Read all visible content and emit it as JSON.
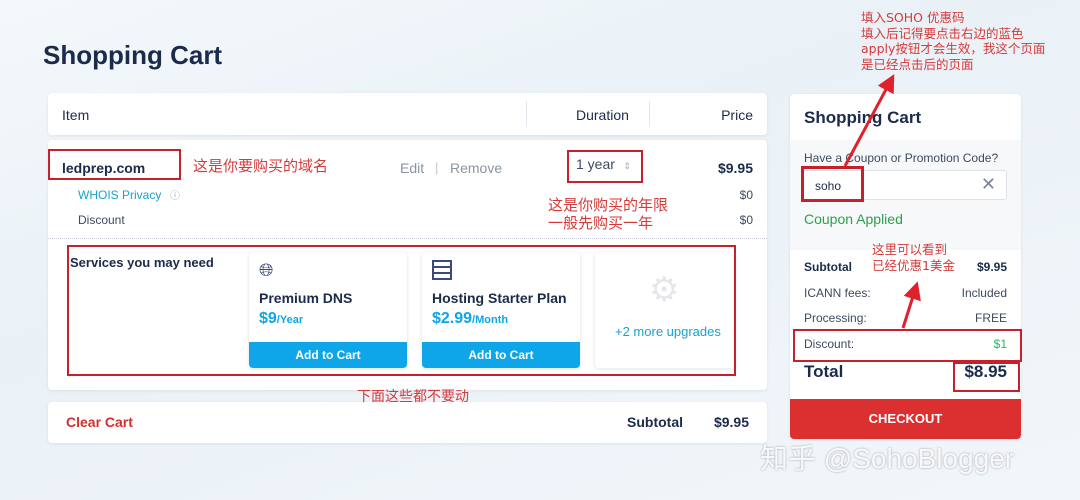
{
  "page_title": "Shopping Cart",
  "table": {
    "col_item": "Item",
    "col_duration": "Duration",
    "col_price": "Price"
  },
  "domain": {
    "name": "ledprep.com",
    "edit": "Edit",
    "separator": "|",
    "remove": "Remove",
    "duration": "1 year",
    "price": "$9.95",
    "whois_label": "WHOIS Privacy",
    "whois_price": "$0",
    "discount_label": "Discount",
    "discount_price": "$0"
  },
  "services": {
    "heading": "Services you may need",
    "items": [
      {
        "name": "Premium DNS",
        "price": "$9",
        "unit": "/Year",
        "button": "Add to Cart",
        "icon": "globe-icon"
      },
      {
        "name": "Hosting Starter Plan",
        "price": "$2.99",
        "unit": "/Month",
        "button": "Add to Cart",
        "icon": "server-icon"
      }
    ],
    "more": "+2 more upgrades"
  },
  "footer": {
    "clear": "Clear Cart",
    "subtotal_label": "Subtotal",
    "subtotal": "$9.95"
  },
  "summary": {
    "title": "Shopping Cart",
    "coupon_label": "Have a Coupon or Promotion Code?",
    "coupon_value": "soho",
    "coupon_status": "Coupon Applied",
    "rows": [
      {
        "label": "Subtotal",
        "value": "$9.95"
      },
      {
        "label": "ICANN fees:",
        "value": "Included"
      },
      {
        "label": "Processing:",
        "value": "FREE"
      },
      {
        "label": "Discount:",
        "value": "$1"
      }
    ],
    "total_label": "Total",
    "total": "$8.95",
    "checkout": "CHECKOUT"
  },
  "annotations": {
    "domain": "这是你要购买的域名",
    "years1": "这是你购买的年限",
    "years2": "一般先购买一年",
    "below": "下面这些都不要动",
    "coupon1": "填入SOHO 优惠码",
    "coupon2": "填入后记得要点击右边的蓝色",
    "coupon3": "apply按钮才会生效，我这个页面",
    "coupon4": "是已经点击后的页面",
    "discount1": "这里可以看到",
    "discount2": "已经优惠1美金"
  },
  "watermark": "知乎 @SohoBlogger",
  "colors": {
    "navy": "#1b2b4b",
    "accent": "#0ea5e9",
    "checkout": "#dc2f2f",
    "success": "#2e9e4f",
    "annotation": "#c8202a"
  }
}
